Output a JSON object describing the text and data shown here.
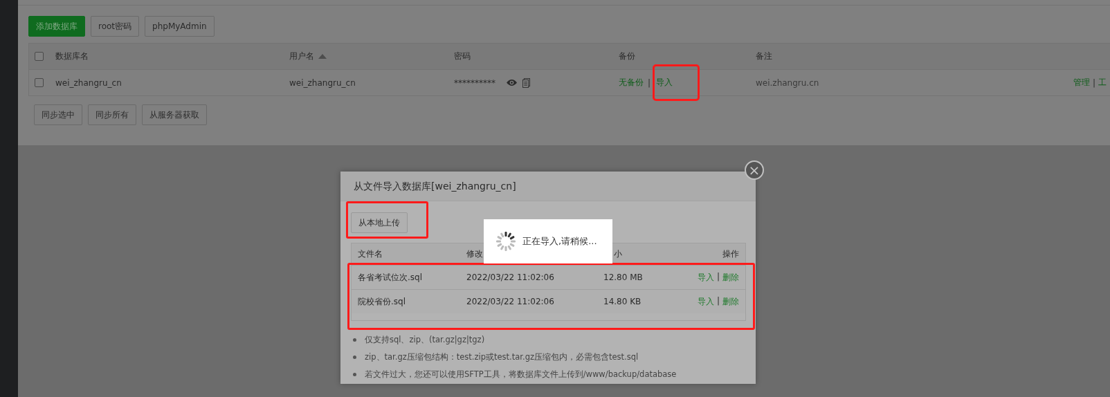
{
  "toolbar": [
    {
      "label": "添加数据库",
      "kind": "primary"
    },
    {
      "label": "root密码",
      "kind": "default"
    },
    {
      "label": "phpMyAdmin",
      "kind": "default"
    }
  ],
  "table": {
    "header_checkbox": {
      "checked": false
    },
    "columns": [
      {
        "label": "数据库名",
        "sorted": false
      },
      {
        "label": "用户名",
        "sorted": true
      },
      {
        "label": "密码",
        "sorted": false
      },
      {
        "label": "备份",
        "sorted": false
      },
      {
        "label": "备注",
        "sorted": false
      }
    ],
    "rows": [
      {
        "checked": false,
        "name": "wei_zhangru_cn",
        "user": "wei_zhangru_cn",
        "password": "**********",
        "backup_status": "无备份",
        "backup_separator": "|",
        "import_link": {
          "label": "导入",
          "highlighted": true
        },
        "note": "wei.zhangru.cn",
        "actions": [
          "管理",
          "|",
          "工"
        ]
      }
    ]
  },
  "footer_buttons": [
    "同步选中",
    "同步所有",
    "从服务器获取"
  ],
  "dialog": {
    "title": "从文件导入数据库[wei_zhangru_cn]",
    "close": "×",
    "upload_button": {
      "label": "从本地上传",
      "highlighted": true
    },
    "file_table": {
      "highlighted": true,
      "columns": [
        "文件名",
        "修改",
        "小",
        "操作"
      ],
      "rows": [
        {
          "name": "各省考试位次.sql",
          "modified": "2022/03/22 11:02:06",
          "size": "12.80 MB",
          "import": "导入",
          "separator": "|",
          "delete": "删除"
        },
        {
          "name": "院校省份.sql",
          "modified": "2022/03/22 11:02:06",
          "size": "14.80 KB",
          "import": "导入",
          "separator": "|",
          "delete": "删除"
        }
      ]
    },
    "notes": [
      "仅支持sql、zip、(tar.gz|gz|tgz)",
      "zip、tar.gz压缩包结构：test.zip或test.tar.gz压缩包内，必需包含test.sql",
      "若文件过大，您还可以使用SFTP工具，将数据库文件上传到/www/backup/database"
    ]
  },
  "loading": {
    "message": "正在导入,请稍候..."
  }
}
